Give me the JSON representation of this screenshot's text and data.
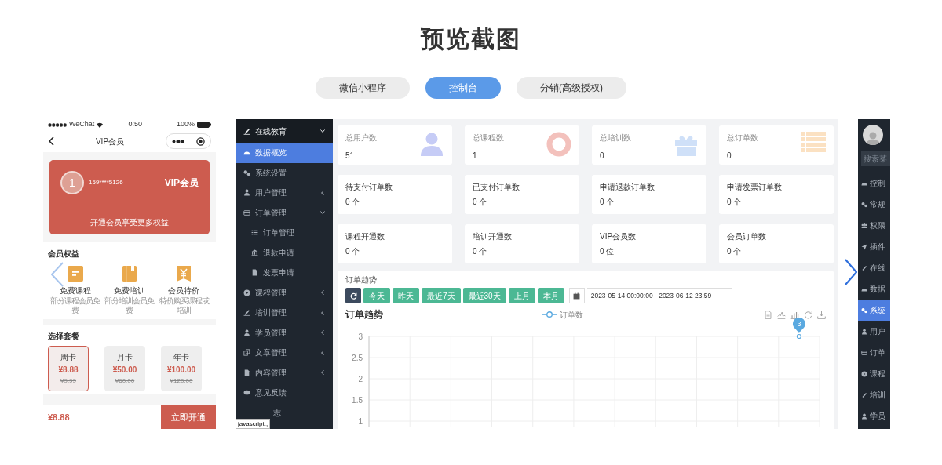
{
  "page": {
    "title": "预览截图"
  },
  "tabs": [
    {
      "label": "微信小程序",
      "selected": false
    },
    {
      "label": "控制台",
      "selected": true
    },
    {
      "label": "分销(高级授权)",
      "selected": false
    }
  ],
  "phone": {
    "status_bar": {
      "carrier": "WeChat",
      "time": "0:50",
      "battery": "100%"
    },
    "nav_title": "VIP会员",
    "member_card": {
      "avatar": "1",
      "phone": "159****5126",
      "badge": "VIP会员",
      "slogan": "开通会员享受更多权益"
    },
    "benefits": {
      "title": "会员权益",
      "items": [
        {
          "kind": "course",
          "title": "免费课程",
          "desc": "部分课程会员免费"
        },
        {
          "kind": "training",
          "title": "免费培训",
          "desc": "部分培训会员免费"
        },
        {
          "kind": "discount",
          "title": "会员特价",
          "desc": "特价购买课程或培训"
        }
      ]
    },
    "plans": {
      "title": "选择套餐",
      "items": [
        {
          "name": "周卡",
          "price": "¥8.88",
          "original": "¥9.99",
          "selected": true
        },
        {
          "name": "月卡",
          "price": "¥50.00",
          "original": "¥60.00",
          "selected": false
        },
        {
          "name": "年卡",
          "price": "¥100.00",
          "original": "¥120.00",
          "selected": false
        }
      ]
    },
    "footer": {
      "total": "¥8.88",
      "button": "立即开通"
    }
  },
  "dashboard": {
    "sidebar": {
      "items": [
        {
          "label": "在线教育",
          "selected": false,
          "expanded": true,
          "children": [
            {
              "label": "数据概览",
              "selected": true
            },
            {
              "label": "系统设置",
              "selected": false
            },
            {
              "label": "用户管理",
              "selected": false,
              "expanded": false
            },
            {
              "label": "订单管理",
              "selected": false,
              "expanded": true,
              "children": [
                {
                  "label": "订单管理",
                  "selected": false
                },
                {
                  "label": "退款申请",
                  "selected": false
                },
                {
                  "label": "发票申请",
                  "selected": false
                }
              ]
            },
            {
              "label": "课程管理",
              "selected": false,
              "expanded": false
            },
            {
              "label": "培训管理",
              "selected": false,
              "expanded": false
            },
            {
              "label": "学员管理",
              "selected": false,
              "expanded": false
            },
            {
              "label": "文章管理",
              "selected": false,
              "expanded": false
            },
            {
              "label": "内容管理",
              "selected": false,
              "expanded": false
            },
            {
              "label": "意见反馈",
              "selected": false
            },
            {
              "label": "志",
              "selected": false
            }
          ]
        }
      ]
    },
    "status_tooltip": "javascript:;",
    "stats": [
      {
        "kind": "total",
        "label": "总用户数",
        "value": "51"
      },
      {
        "kind": "total",
        "label": "总课程数",
        "value": "1"
      },
      {
        "kind": "total",
        "label": "总培训数",
        "value": "0"
      },
      {
        "kind": "total",
        "label": "总订单数",
        "value": "0"
      },
      {
        "kind": "count",
        "label": "待支付订单数",
        "value": "0 个"
      },
      {
        "kind": "count",
        "label": "已支付订单数",
        "value": "0 个"
      },
      {
        "kind": "count",
        "label": "申请退款订单数",
        "value": "0 个"
      },
      {
        "kind": "count",
        "label": "申请发票订单数",
        "value": "0 个"
      },
      {
        "kind": "count",
        "label": "课程开通数",
        "value": "0 个"
      },
      {
        "kind": "count",
        "label": "培训开通数",
        "value": "0 个"
      },
      {
        "kind": "count",
        "label": "VIP会员数",
        "value": "0 位"
      },
      {
        "kind": "count",
        "label": "会员订单数",
        "value": "0 个"
      }
    ],
    "trend": {
      "label": "订单趋势",
      "ranges": [
        "今天",
        "昨天",
        "最近7天",
        "最近30天",
        "上月",
        "本月"
      ],
      "date_range": "2023-05-14 00:00:00 - 2023-06-12 23:59",
      "chart_data": {
        "type": "line",
        "title": "订单趋势",
        "series": [
          {
            "name": "订单数",
            "color": "#5aa9e0",
            "marker": "circle",
            "values": [
              null,
              null,
              null,
              null,
              null,
              null,
              null,
              null,
              null,
              null,
              3
            ]
          }
        ],
        "categories": [
          null,
          null,
          null,
          null,
          null,
          null,
          null,
          null,
          null,
          null,
          null
        ],
        "ylim": [
          1,
          3
        ],
        "yticks": [
          1,
          1.5,
          2,
          2.5,
          3
        ],
        "grid": true,
        "data_labels": true
      }
    }
  },
  "next_preview": {
    "search_placeholder": "搜索菜",
    "items": [
      {
        "label": "控制",
        "selected": false
      },
      {
        "label": "常规",
        "selected": false
      },
      {
        "label": "权限",
        "selected": false
      },
      {
        "label": "插件",
        "selected": false
      },
      {
        "label": "在线",
        "selected": false
      },
      {
        "label": "数据",
        "selected": false
      },
      {
        "label": "系统",
        "selected": true
      },
      {
        "label": "用户",
        "selected": false
      },
      {
        "label": "订单",
        "selected": false
      },
      {
        "label": "课程",
        "selected": false
      },
      {
        "label": "培训",
        "selected": false
      },
      {
        "label": "学员",
        "selected": false
      }
    ]
  }
}
